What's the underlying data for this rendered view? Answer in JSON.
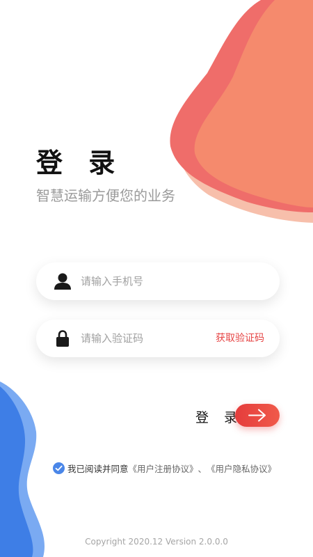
{
  "header": {
    "title": "登 录",
    "subtitle": "智慧运输方便您的业务"
  },
  "form": {
    "phone_placeholder": "请输入手机号",
    "code_placeholder": "请输入验证码",
    "get_code_label": "获取验证码",
    "login_label": "登 录"
  },
  "agreement": {
    "checked": true,
    "prefix": "我已阅读并同意",
    "user_agreement": "《用户注册协议》",
    "separator": "、",
    "privacy_agreement": "《用户隐私协议》"
  },
  "footer": {
    "copyright": "Copyright  2020.12 Version 2.0.0.0"
  },
  "colors": {
    "accent_red": "#e64545",
    "accent_blue": "#4a86e8"
  }
}
